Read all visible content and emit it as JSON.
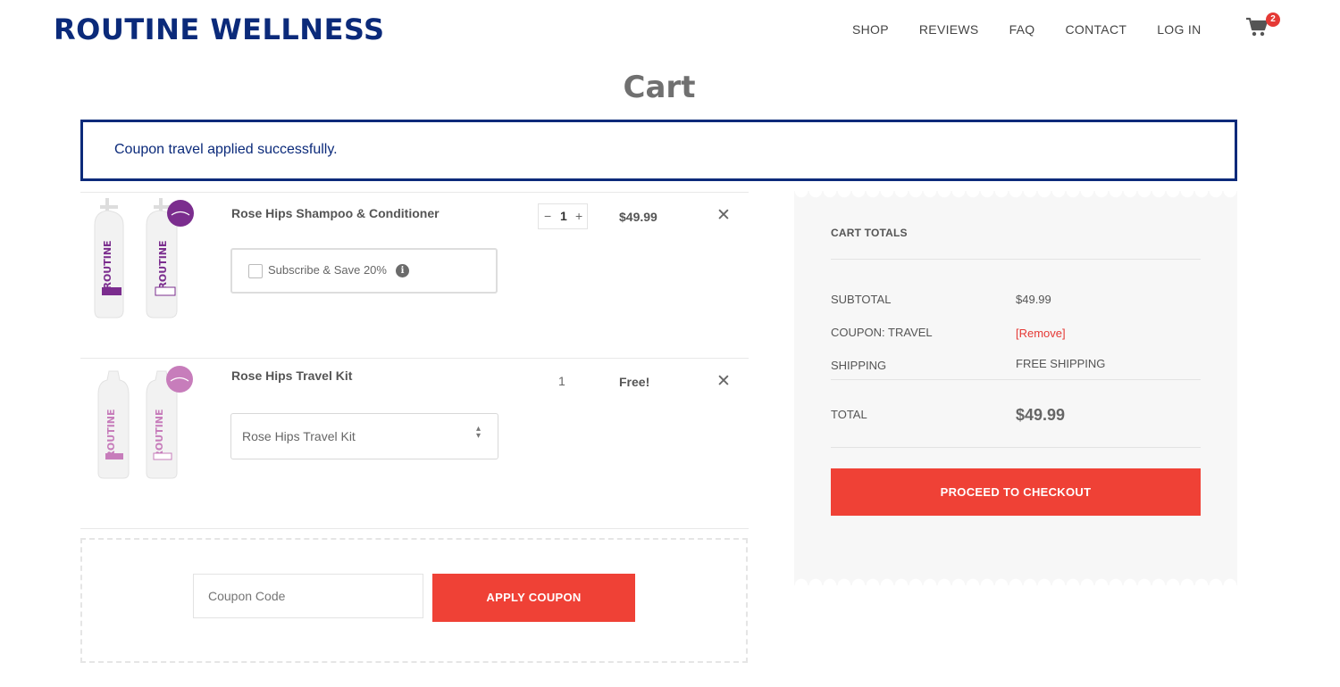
{
  "header": {
    "logo": "ROUTINE WELLNESS",
    "nav": [
      "SHOP",
      "REVIEWS",
      "FAQ",
      "CONTACT",
      "LOG IN"
    ],
    "cart_count": "2",
    "cart_icon": "cart-icon"
  },
  "page_title": "Cart",
  "notice": "Coupon travel applied successfully.",
  "items": [
    {
      "name": "Rose Hips Shampoo & Conditioner",
      "quantity": "1",
      "minus": "−",
      "plus": "+",
      "price": "$49.99",
      "remove": "✕",
      "subscribe_label": "Subscribe & Save 20%",
      "info": "i"
    },
    {
      "name": "Rose Hips Travel Kit",
      "quantity": "1",
      "price": "Free!",
      "remove": "✕",
      "select_value": "Rose Hips Travel Kit"
    }
  ],
  "coupon": {
    "placeholder": "Coupon Code",
    "apply_label": "APPLY COUPON"
  },
  "totals": {
    "title": "CART TOTALS",
    "subtotal_label": "SUBTOTAL",
    "subtotal_value": "$49.99",
    "coupon_label": "COUPON: TRAVEL",
    "coupon_remove": "[Remove]",
    "shipping_label": "SHIPPING",
    "shipping_value": "FREE SHIPPING",
    "total_label": "TOTAL",
    "total_value": "$49.99",
    "checkout_label": "PROCEED TO CHECKOUT"
  },
  "colors": {
    "brand_navy": "#0b2a7a",
    "accent_red": "#ef4136",
    "product_purple": "#7b2d8e",
    "product_pink": "#c77dbb"
  }
}
